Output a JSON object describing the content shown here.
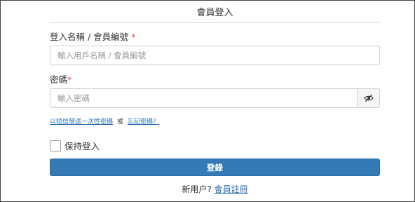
{
  "form": {
    "title": "會員登入",
    "username": {
      "label": "登入名稱 / 會員編號",
      "required_mark": "*",
      "placeholder": "輸入用戶名稱 / 會員編號"
    },
    "password": {
      "label": "密碼",
      "required_mark": "*",
      "placeholder": "輸入密碼",
      "toggle_icon": "eye-slash-icon"
    },
    "links": {
      "otp": "以短信發送一次性密碼",
      "or": "或",
      "forgot": "忘記密碼？"
    },
    "remember": {
      "label": "保持登入",
      "checked": false
    },
    "submit_label": "登錄",
    "footer": {
      "prompt": "新用户?",
      "register_link": "會員註冊"
    }
  },
  "colors": {
    "primary": "#337ab7",
    "link": "#2a6fb5",
    "required": "#d9534f"
  }
}
